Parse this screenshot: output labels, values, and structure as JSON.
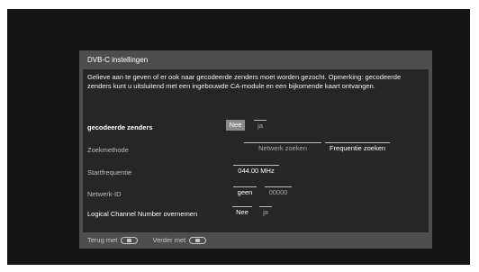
{
  "dialog": {
    "title": "DVB-C instellingen",
    "description": "Gelieve aan te geven of er ook naar gecodeerde zenders moet worden gezocht. Opmerking: gecodeerde zenders kunt u uitsluitend met een ingebouwde CA-module en een bijkomende kaart ontvangen."
  },
  "rows": {
    "encrypted": {
      "label": "gecodeerde zenders",
      "options": [
        "Nee",
        "ja"
      ]
    },
    "search_method": {
      "label": "Zoekmethode",
      "options": [
        "Netwerk zoeken",
        "Frequentie zoeken"
      ]
    },
    "start_frequency": {
      "label": "Startfrequentie",
      "value": "044.00 MHz"
    },
    "network_id": {
      "label": "Netwerk-ID",
      "options": [
        "geen",
        "00000"
      ]
    },
    "lcn": {
      "label": "Logical Channel Number overnemen",
      "options": [
        "Nee",
        "ja"
      ]
    }
  },
  "footer": {
    "back_label": "Terug met",
    "next_label": "Verder met"
  },
  "colors": {
    "screen_bg": "#141414",
    "dialog_bg": "#4d4d4d",
    "panel_bg": "#262626",
    "selected_box": "#8a8a8a"
  }
}
